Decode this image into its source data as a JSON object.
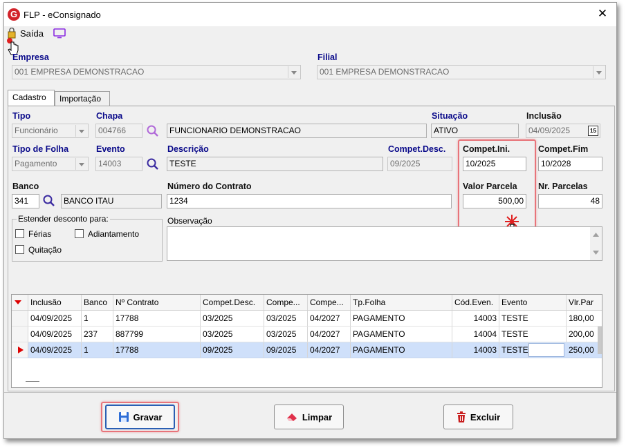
{
  "window": {
    "title": "FLP - eConsignado",
    "close": "✕"
  },
  "toolbar": {
    "exit_label": "Saída"
  },
  "empresa": {
    "label": "Empresa",
    "value": "001 EMPRESA DEMONSTRACAO"
  },
  "filial": {
    "label": "Filial",
    "value": "001 EMPRESA DEMONSTRACAO"
  },
  "tabs": [
    {
      "label": "Cadastro"
    },
    {
      "label": "Importação"
    }
  ],
  "form": {
    "tipo": {
      "label": "Tipo",
      "value": "Funcionário"
    },
    "chapa": {
      "label": "Chapa",
      "value": "004766"
    },
    "nome": {
      "value": "FUNCIONARIO DEMONSTRACAO"
    },
    "situacao": {
      "label": "Situação",
      "value": "ATIVO"
    },
    "inclusao": {
      "label": "Inclusão",
      "value": "04/09/2025",
      "cal": "15"
    },
    "tipo_folha": {
      "label": "Tipo de Folha",
      "value": "Pagamento"
    },
    "evento": {
      "label": "Evento",
      "value": "14003"
    },
    "descricao": {
      "label": "Descrição",
      "value": "TESTE"
    },
    "compet_desc": {
      "label": "Compet.Desc.",
      "value": "09/2025"
    },
    "compet_ini": {
      "label": "Compet.Ini.",
      "value": "10/2025"
    },
    "compet_fim": {
      "label": "Compet.Fim",
      "value": "10/2028"
    },
    "banco": {
      "label": "Banco",
      "code": "341",
      "name": "BANCO ITAU"
    },
    "numero_contrato": {
      "label": "Número do Contrato",
      "value": "1234"
    },
    "valor_parcela": {
      "label": "Valor Parcela",
      "value": "500,00"
    },
    "nr_parcelas": {
      "label": "Nr. Parcelas",
      "value": "48"
    },
    "estender": {
      "label": "Estender desconto para:",
      "ferias": "Férias",
      "adiantamento": "Adiantamento",
      "quitacao": "Quitação"
    },
    "observacao": {
      "label": "Observação"
    }
  },
  "grid": {
    "headers": [
      "Inclusão",
      "Banco",
      "Nº Contrato",
      "Compet.Desc.",
      "Compe...",
      "Compe...",
      "Tp.Folha",
      "Cód.Even.",
      "Evento",
      "Vlr.Par"
    ],
    "rows": [
      [
        "04/09/2025",
        "1",
        "17788",
        "03/2025",
        "03/2025",
        "04/2027",
        "PAGAMENTO",
        "14003",
        "TESTE",
        "180,00"
      ],
      [
        "04/09/2025",
        "237",
        "887799",
        "03/2025",
        "03/2025",
        "04/2027",
        "PAGAMENTO",
        "14004",
        "TESTE",
        "200,00"
      ],
      [
        "04/09/2025",
        "1",
        "17788",
        "09/2025",
        "09/2025",
        "04/2027",
        "PAGAMENTO",
        "14003",
        "TESTE",
        "250,00"
      ]
    ],
    "selected_row": 2
  },
  "buttons": {
    "gravar": "Gravar",
    "limpar": "Limpar",
    "excluir": "Excluir"
  },
  "colors": {
    "label_blue": "#0a0a8a",
    "highlight": "#e8747a",
    "selected_row": "#cfe0fa",
    "brand_red": "#d2232a"
  }
}
